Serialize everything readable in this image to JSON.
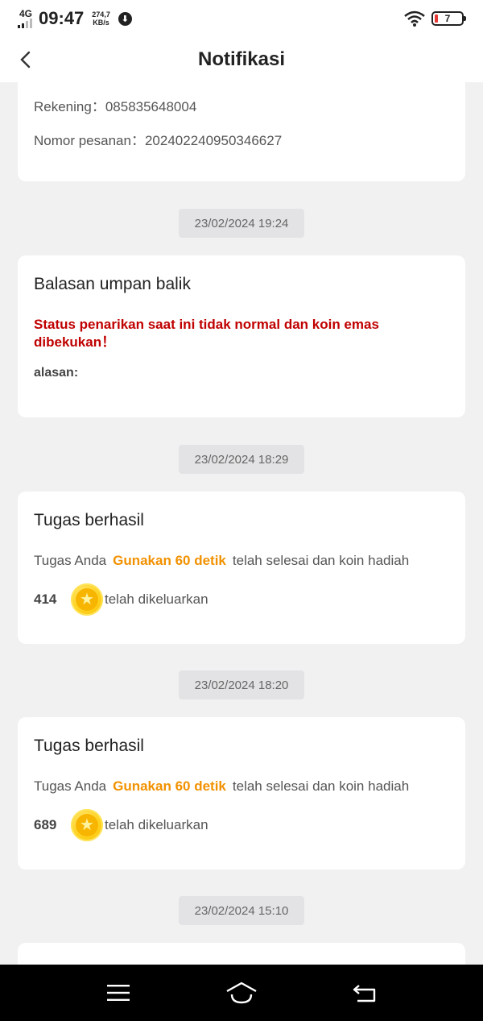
{
  "status_bar": {
    "network": "4G",
    "time": "09:47",
    "speed_value": "274,7",
    "speed_unit": "KB/s",
    "battery": "7",
    "battery_color": "#e53935"
  },
  "header": {
    "title": "Notifikasi",
    "back_icon": "chevron-left-icon"
  },
  "cards": [
    {
      "partial": true,
      "rekening_label": "Rekening：",
      "rekening_value": "085835648004",
      "order_label": "Nomor pesanan：",
      "order_value": "202402240950346627"
    },
    {
      "date": "23/02/2024 19:24",
      "title": "Balasan umpan balik",
      "warning": "Status penarikan saat ini tidak normal dan koin emas dibekukan！",
      "reason_label": "alasan:"
    },
    {
      "date": "23/02/2024 18:29",
      "title": "Tugas berhasil",
      "prefix": "Tugas Anda",
      "highlight": "Gunakan 60 detik",
      "suffix": "telah selesai dan koin hadiah",
      "amount": "414",
      "released": "telah dikeluarkan"
    },
    {
      "date": "23/02/2024 18:20",
      "title": "Tugas berhasil",
      "prefix": "Tugas Anda",
      "highlight": "Gunakan 60 detik",
      "suffix": "telah selesai dan koin hadiah",
      "amount": "689",
      "released": "telah dikeluarkan"
    },
    {
      "date": "23/02/2024 15:10"
    }
  ],
  "colors": {
    "highlight": "#f29100",
    "warning": "#c00000",
    "coin": "#ffd21f"
  },
  "nav_bar": {
    "icons": [
      "menu-icon",
      "home-icon",
      "back-icon"
    ]
  }
}
